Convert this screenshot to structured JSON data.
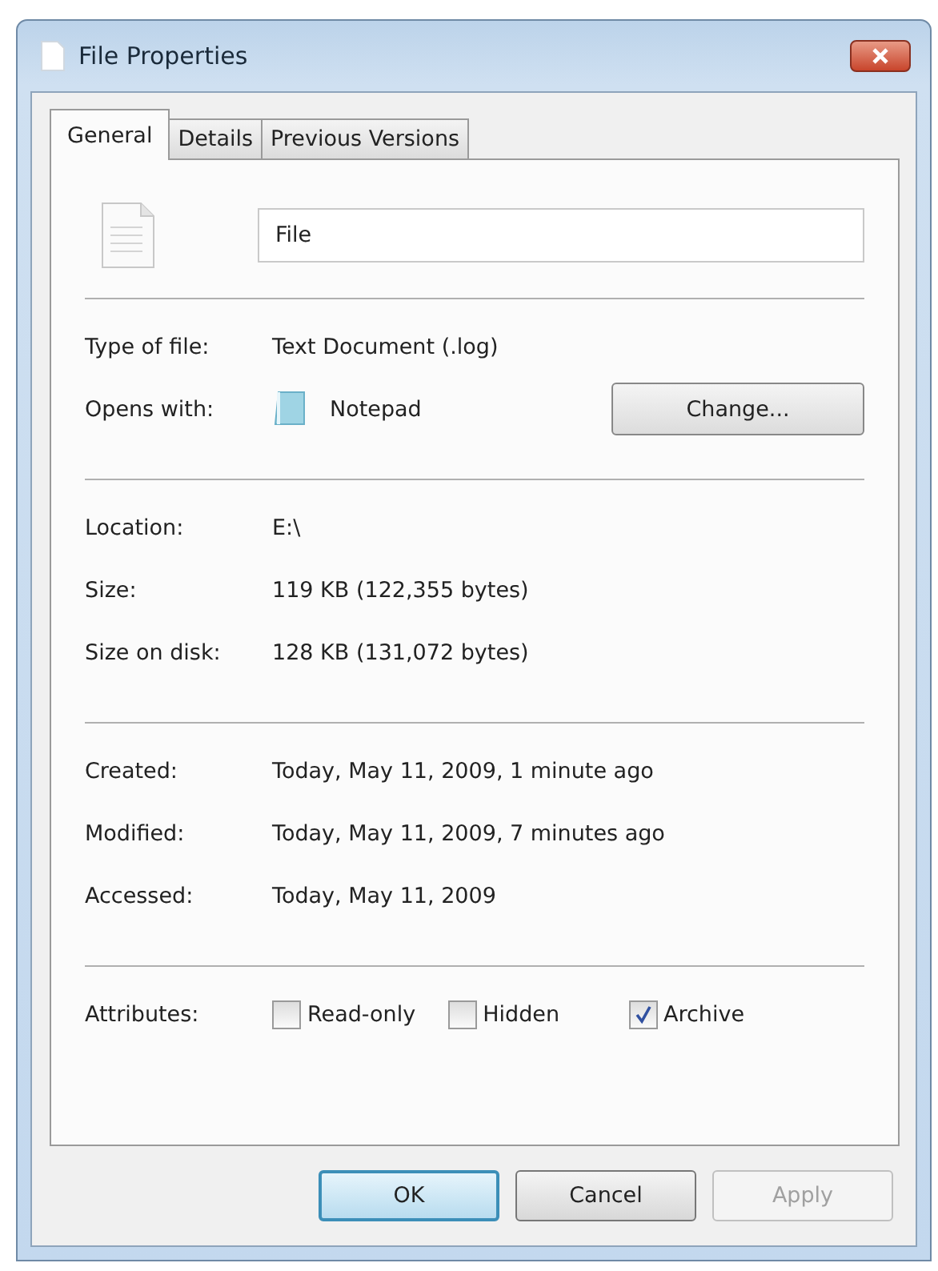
{
  "window": {
    "title": "File Properties"
  },
  "tabs": [
    {
      "label": "General",
      "selected": true
    },
    {
      "label": "Details",
      "selected": false
    },
    {
      "label": "Previous Versions",
      "selected": false
    }
  ],
  "file_name": "File",
  "sections": [
    [
      {
        "kind": "text",
        "label": "Type of file:",
        "value": "Text Document (.log)"
      },
      {
        "kind": "app",
        "label": "Opens with:",
        "value": "Notepad",
        "button": "Change..."
      }
    ],
    [
      {
        "kind": "text",
        "label": "Location:",
        "value": "E:\\"
      },
      {
        "kind": "text",
        "label": "Size:",
        "value": "119 KB (122,355 bytes)"
      },
      {
        "kind": "text",
        "label": "Size on disk:",
        "value": "128 KB (131,072 bytes)"
      }
    ],
    [
      {
        "kind": "text",
        "label": "Created:",
        "value": "Today, May 11, 2009, 1 minute ago"
      },
      {
        "kind": "text",
        "label": "Modified:",
        "value": "Today, May 11, 2009, 7 minutes ago"
      },
      {
        "kind": "text",
        "label": "Accessed:",
        "value": "Today, May 11, 2009"
      }
    ]
  ],
  "attributes": {
    "label": "Attributes:",
    "items": [
      {
        "label": "Read-only",
        "checked": false
      },
      {
        "label": "Hidden",
        "checked": false
      },
      {
        "label": "Archive",
        "checked": true
      }
    ]
  },
  "buttons": [
    {
      "label": "OK",
      "default": true,
      "disabled": false
    },
    {
      "label": "Cancel",
      "default": false,
      "disabled": false
    },
    {
      "label": "Apply",
      "default": false,
      "disabled": true
    }
  ]
}
